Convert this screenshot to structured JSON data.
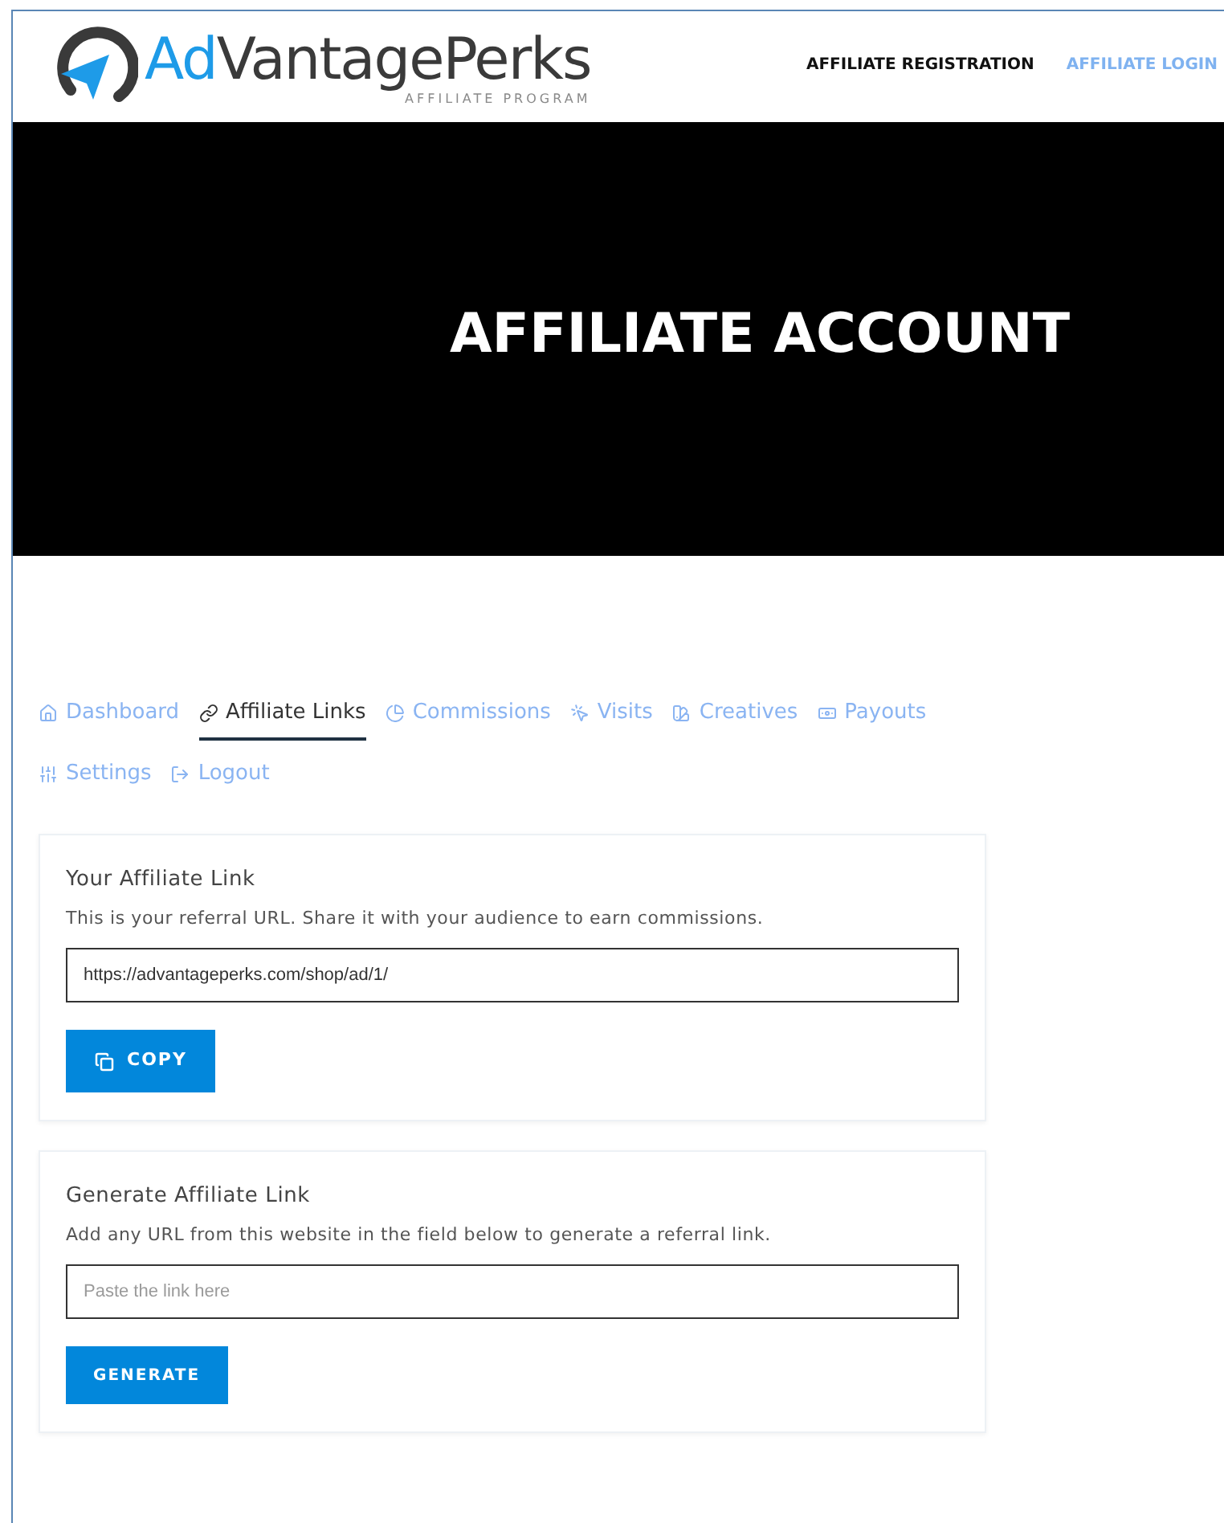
{
  "logo": {
    "prefix": "Ad",
    "name": "VantagePerks",
    "tagline": "AFFILIATE PROGRAM"
  },
  "nav": [
    {
      "label": "AFFILIATE REGISTRATION",
      "highlighted": false
    },
    {
      "label": "AFFILIATE LOGIN",
      "highlighted": true
    }
  ],
  "hero": {
    "title": "AFFILIATE ACCOUNT"
  },
  "tabs": [
    {
      "label": "Dashboard",
      "selected": false
    },
    {
      "label": "Affiliate Links",
      "selected": true
    },
    {
      "label": "Commissions",
      "selected": false
    },
    {
      "label": "Visits",
      "selected": false
    },
    {
      "label": "Creatives",
      "selected": false
    },
    {
      "label": "Payouts",
      "selected": false
    },
    {
      "label": "Settings",
      "selected": false
    },
    {
      "label": "Logout",
      "selected": false
    }
  ],
  "cards": [
    {
      "title": "Your Affiliate Link",
      "description": "This is your referral URL. Share it with your audience to earn commissions.",
      "value": "https://advantageperks.com/shop/ad/1/",
      "button": "COPY",
      "kind": "copy"
    },
    {
      "title": "Generate Affiliate Link",
      "description": "Add any URL from this website in the field below to generate a referral link.",
      "placeholder": "Paste the link here",
      "button": "GENERATE",
      "kind": "generate"
    }
  ]
}
